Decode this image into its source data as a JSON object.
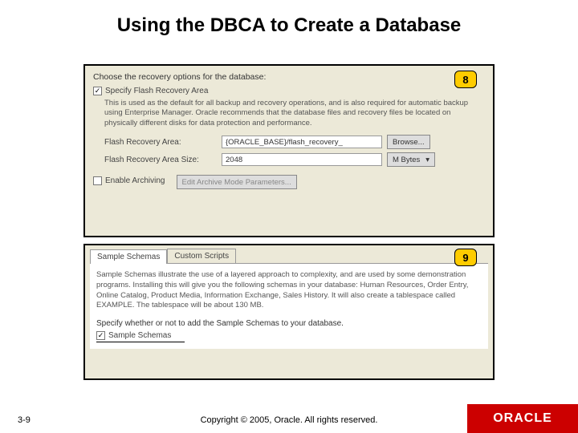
{
  "title": "Using the DBCA to Create a Database",
  "callouts": {
    "c8": "8",
    "c9": "9"
  },
  "panel1": {
    "prompt": "Choose the recovery options for the database:",
    "specify_flash_label": "Specify Flash Recovery Area",
    "desc": "This is used as the default for all backup and recovery operations, and is also required for automatic backup using Enterprise Manager. Oracle recommends that the database files and recovery files be located on physically different disks for data protection and performance.",
    "area_label": "Flash Recovery Area:",
    "area_value": "{ORACLE_BASE}/flash_recovery_",
    "browse_label": "Browse...",
    "size_label": "Flash Recovery Area Size:",
    "size_value": "2048",
    "size_unit": "M Bytes",
    "enable_arch_label": "Enable Archiving",
    "edit_arch_label": "Edit Archive Mode Parameters..."
  },
  "panel2": {
    "tab1": "Sample Schemas",
    "tab2": "Custom Scripts",
    "desc": "Sample Schemas illustrate the use of a layered approach to complexity, and are used by some demonstration programs. Installing this will give you the following schemas in your database: Human Resources, Order Entry, Online Catalog, Product Media, Information Exchange, Sales History. It will also create a tablespace called EXAMPLE. The tablespace will be about 130 MB.",
    "specify": "Specify whether or not to add the Sample Schemas to your database.",
    "sample_label": "Sample Schemas"
  },
  "footer": {
    "pagenum": "3-9",
    "copyright": "Copyright © 2005, Oracle. All rights reserved.",
    "brand": "ORACLE"
  }
}
